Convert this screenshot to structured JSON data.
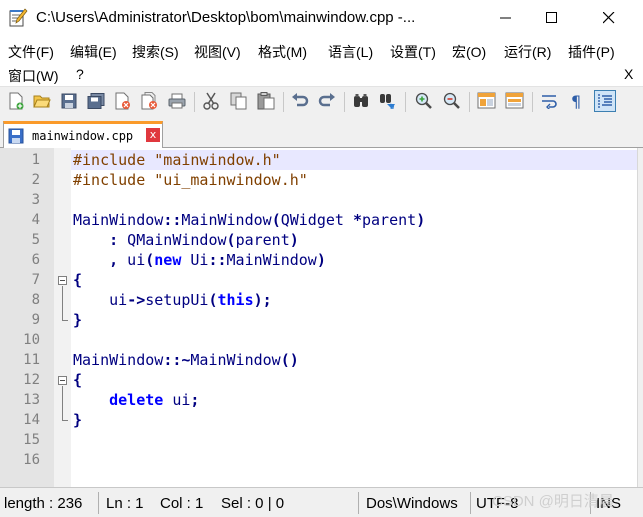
{
  "window": {
    "title": "C:\\Users\\Administrator\\Desktop\\bom\\mainwindow.cpp -..."
  },
  "menu": {
    "row1": [
      "文件(F)",
      "编辑(E)",
      "搜索(S)",
      "视图(V)",
      "格式(M)",
      "语言(L)",
      "设置(T)",
      "宏(O)",
      "运行(R)",
      "插件(P)"
    ],
    "row2": [
      "窗口(W)",
      "?"
    ],
    "close_label": "X"
  },
  "toolbar": {
    "icons": [
      "new-file-icon",
      "open-file-icon",
      "save-icon",
      "save-all-icon",
      "close-icon",
      "close-all-icon",
      "print-icon",
      "cut-icon",
      "copy-icon",
      "paste-icon",
      "undo-icon",
      "redo-icon",
      "find-icon",
      "replace-icon",
      "zoom-in-icon",
      "zoom-out-icon",
      "sync-vertical-icon",
      "sync-horizontal-icon",
      "word-wrap-icon",
      "show-all-chars-icon",
      "indent-guide-icon"
    ]
  },
  "tab": {
    "label": "mainwindow.cpp",
    "close_glyph": "x"
  },
  "editor": {
    "line_numbers": [
      "1",
      "2",
      "3",
      "4",
      "5",
      "6",
      "7",
      "8",
      "9",
      "10",
      "11",
      "12",
      "13",
      "14",
      "15",
      "16"
    ],
    "current_line": 1,
    "lines": [
      [
        {
          "t": "#include ",
          "c": "tk-pre"
        },
        {
          "t": "\"mainwindow.h\"",
          "c": "tk-str2"
        }
      ],
      [
        {
          "t": "#include ",
          "c": "tk-pre"
        },
        {
          "t": "\"ui_mainwindow.h\"",
          "c": "tk-str2"
        }
      ],
      [],
      [
        {
          "t": "MainWindow",
          "c": "tk-def"
        },
        {
          "t": "::",
          "c": "tk-op"
        },
        {
          "t": "MainWindow",
          "c": "tk-def"
        },
        {
          "t": "(",
          "c": "tk-op"
        },
        {
          "t": "QWidget ",
          "c": "tk-def"
        },
        {
          "t": "*",
          "c": "tk-op"
        },
        {
          "t": "parent",
          "c": "tk-def"
        },
        {
          "t": ")",
          "c": "tk-op"
        }
      ],
      [
        {
          "t": "    ",
          "c": ""
        },
        {
          "t": ":",
          "c": "tk-op"
        },
        {
          "t": " QMainWindow",
          "c": "tk-def"
        },
        {
          "t": "(",
          "c": "tk-op"
        },
        {
          "t": "parent",
          "c": "tk-def"
        },
        {
          "t": ")",
          "c": "tk-op"
        }
      ],
      [
        {
          "t": "    ",
          "c": ""
        },
        {
          "t": ",",
          "c": "tk-op"
        },
        {
          "t": " ui",
          "c": "tk-def"
        },
        {
          "t": "(",
          "c": "tk-op"
        },
        {
          "t": "new",
          "c": "tk-kw"
        },
        {
          "t": " Ui",
          "c": "tk-def"
        },
        {
          "t": "::",
          "c": "tk-op"
        },
        {
          "t": "MainWindow",
          "c": "tk-def"
        },
        {
          "t": ")",
          "c": "tk-op"
        }
      ],
      [
        {
          "t": "{",
          "c": "tk-op"
        }
      ],
      [
        {
          "t": "    ui",
          "c": "tk-def"
        },
        {
          "t": "->",
          "c": "tk-op"
        },
        {
          "t": "setupUi",
          "c": "tk-def"
        },
        {
          "t": "(",
          "c": "tk-op"
        },
        {
          "t": "this",
          "c": "tk-kw"
        },
        {
          "t": ");",
          "c": "tk-op"
        }
      ],
      [
        {
          "t": "}",
          "c": "tk-op"
        }
      ],
      [],
      [
        {
          "t": "MainWindow",
          "c": "tk-def"
        },
        {
          "t": "::~",
          "c": "tk-op"
        },
        {
          "t": "MainWindow",
          "c": "tk-def"
        },
        {
          "t": "()",
          "c": "tk-op"
        }
      ],
      [
        {
          "t": "{",
          "c": "tk-op"
        }
      ],
      [
        {
          "t": "    ",
          "c": ""
        },
        {
          "t": "delete",
          "c": "tk-kw"
        },
        {
          "t": " ui",
          "c": "tk-def"
        },
        {
          "t": ";",
          "c": "tk-op"
        }
      ],
      [
        {
          "t": "}",
          "c": "tk-op"
        }
      ],
      [],
      []
    ]
  },
  "status": {
    "length": "length : 236",
    "ln": "Ln : 1",
    "col": "Col : 1",
    "sel": "Sel : 0 | 0",
    "eol": "Dos\\Windows",
    "encoding": "UTF-8",
    "mode": "INS",
    "watermark": "CSDN @明日清晨"
  },
  "colors": {
    "tab_accent": "#fa9a2a",
    "current_line": "#e8e8ff",
    "keyword": "#0000ff",
    "preprocessor": "#804000",
    "identifier": "#000080"
  }
}
